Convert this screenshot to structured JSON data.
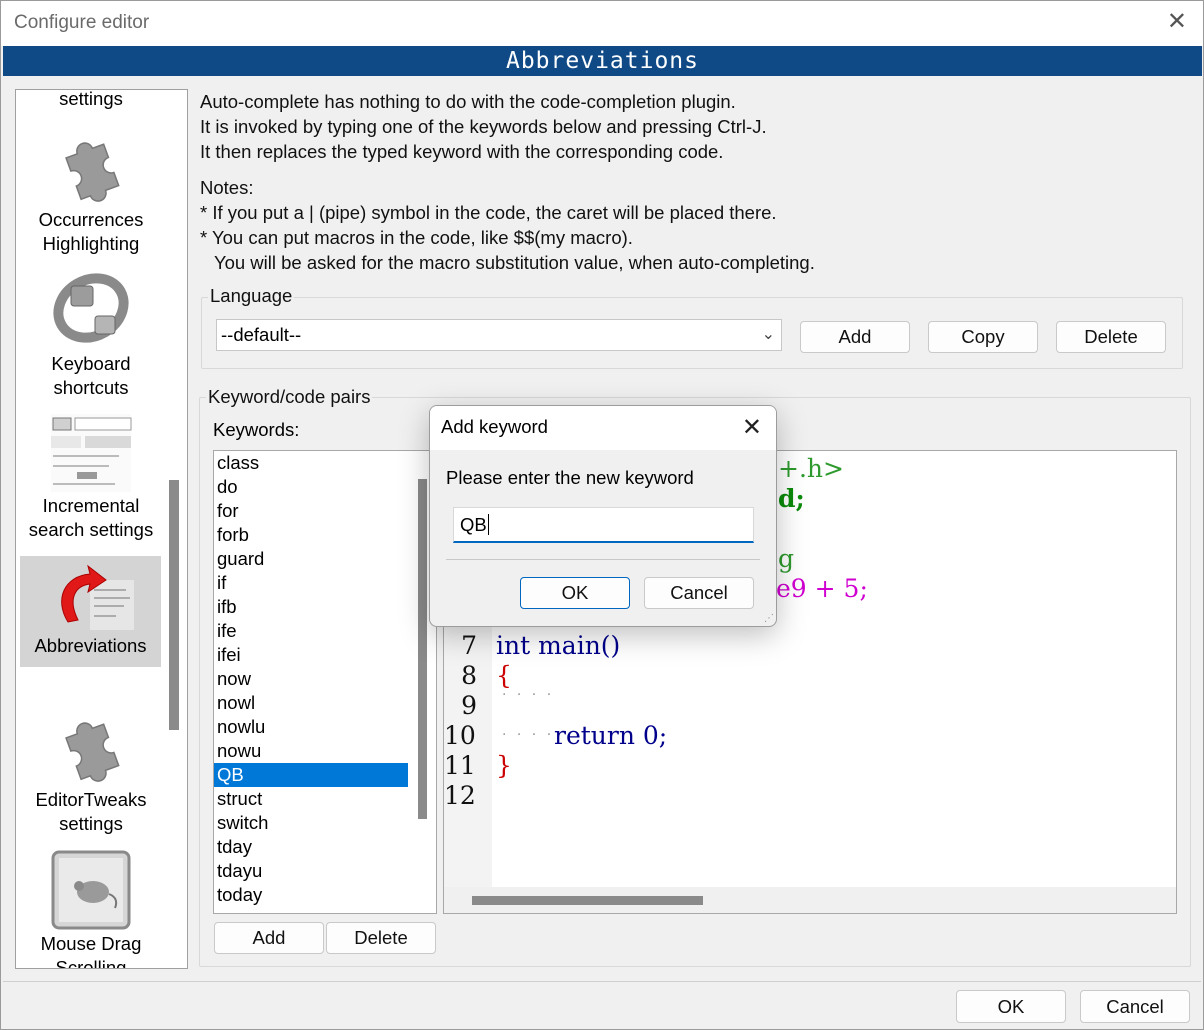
{
  "window": {
    "title": "Configure editor",
    "close": "✕"
  },
  "banner": {
    "title": "Abbreviations"
  },
  "sidebar": {
    "items": [
      {
        "label": "settings"
      },
      {
        "label": "Occurrences\nHighlighting",
        "icon": "puzzle-icon"
      },
      {
        "label": "Keyboard\nshortcuts",
        "icon": "keyboard-ring-icon"
      },
      {
        "label": "Incremental\nsearch settings",
        "icon": "incremental-search-icon"
      },
      {
        "label": "Abbreviations",
        "icon": "abbreviations-icon",
        "selected": true
      },
      {
        "label": "EditorTweaks\nsettings",
        "icon": "puzzle-icon"
      },
      {
        "label": "Mouse Drag\nScrolling",
        "icon": "mouse-scroll-icon"
      }
    ]
  },
  "description": {
    "lines": [
      "Auto-complete has nothing to do with the code-completion plugin.",
      "It is invoked by typing one of the keywords below and pressing Ctrl-J.",
      "It then replaces the typed keyword with the corresponding code."
    ],
    "notes": [
      "Notes:",
      "* If you put a | (pipe) symbol in the code, the caret will be placed there.",
      "* You can put macros in the code, like $$(my macro).",
      "  You will be asked for the macro substitution value, when auto-completing."
    ]
  },
  "language": {
    "group_label": "Language",
    "selected": "--default--",
    "add": "Add",
    "copy": "Copy",
    "delete": "Delete"
  },
  "pairs": {
    "group_label": "Keyword/code pairs",
    "keywords_label": "Keywords:",
    "keywords": [
      "class",
      "do",
      "for",
      "forb",
      "guard",
      "if",
      "ifb",
      "ife",
      "ifei",
      "now",
      "nowl",
      "nowlu",
      "nowu",
      "QB",
      "struct",
      "switch",
      "tday",
      "tdayu",
      "today"
    ],
    "selected_keyword": "QB",
    "add": "Add",
    "delete": "Delete"
  },
  "code_editor": {
    "line_numbers": [
      "7",
      "8",
      "9",
      "10",
      "11",
      "12"
    ],
    "partial_lines": [
      "+.h>",
      "d;",
      "g",
      "e9 + 5;"
    ],
    "lines": [
      "int main()",
      "{",
      "",
      "return 0;",
      "}",
      ""
    ]
  },
  "footer": {
    "ok": "OK",
    "cancel": "Cancel"
  },
  "dialog": {
    "title": "Add keyword",
    "close": "✕",
    "prompt": "Please enter the new keyword",
    "input_value": "QB",
    "ok": "OK",
    "cancel": "Cancel"
  },
  "colors": {
    "banner": "#0f4a86",
    "selection": "#0078d7",
    "keyword_blue": "#00008b",
    "string_green": "#2e9a2e",
    "number_magenta": "#d000d0",
    "brace_red": "#cc0000"
  }
}
